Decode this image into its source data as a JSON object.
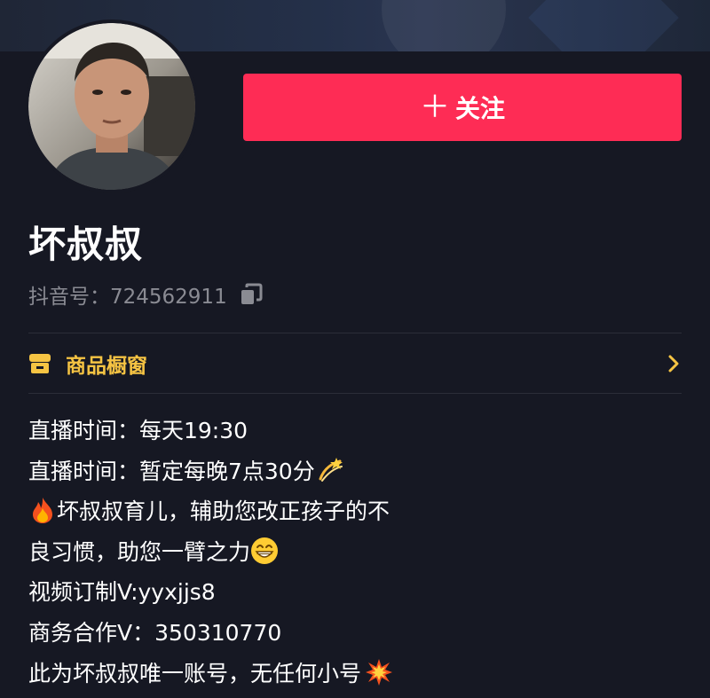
{
  "profile": {
    "name": "坏叔叔",
    "douyin_id_label": "抖音号：724562911"
  },
  "actions": {
    "follow_label": "关注",
    "follow_plus": "＋"
  },
  "shop": {
    "label": "商品橱窗"
  },
  "bio": {
    "lines": [
      "直播时间：每天19:30",
      "直播时间：暂定每晚7点30分",
      "坏叔叔育儿，辅助您改正孩子的不",
      "良习惯，助您一臂之力",
      "视频订制V:yyxjjs8",
      "商务合作V：350310770",
      "此为坏叔叔唯一账号，无任何小号"
    ]
  },
  "colors": {
    "background": "#161823",
    "follow_button": "#fe2c55",
    "shop_accent": "#f6c443",
    "secondary_text": "#8a8b93"
  },
  "icons": {
    "copy": "copy-icon",
    "shop": "shop-icon",
    "chevron": "chevron-right-icon",
    "dizzy": "dizzy-emoji",
    "fire": "fire-emoji",
    "grin": "grin-emoji",
    "collision": "collision-emoji"
  }
}
